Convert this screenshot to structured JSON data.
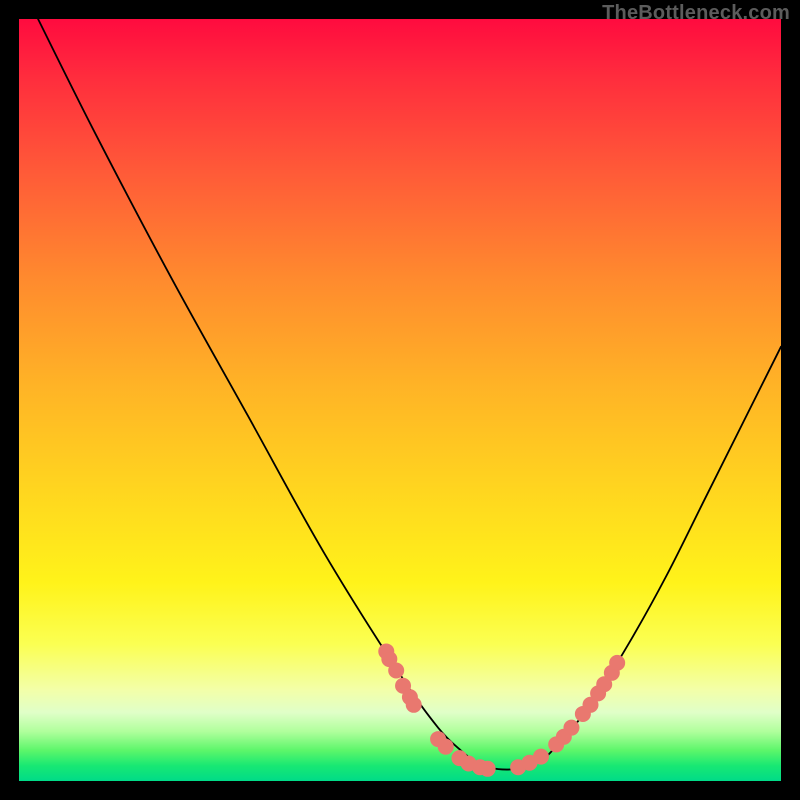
{
  "credit": "TheBottleneck.com",
  "colors": {
    "curve_stroke": "#000000",
    "marker_fill": "#e9786f",
    "marker_stroke": "#e9786f"
  },
  "chart_data": {
    "type": "line",
    "title": "",
    "xlabel": "",
    "ylabel": "",
    "xlim": [
      0,
      100
    ],
    "ylim": [
      0,
      100
    ],
    "series": [
      {
        "name": "curve",
        "x": [
          2.5,
          10,
          20,
          30,
          40,
          50,
          55,
          58,
          60,
          62,
          64,
          66,
          68,
          70,
          75,
          80,
          85,
          90,
          95,
          100
        ],
        "y": [
          100,
          85,
          66,
          48,
          30,
          14,
          7,
          4,
          2.5,
          1.7,
          1.5,
          1.7,
          2.5,
          4,
          10,
          18,
          27,
          37,
          47,
          57
        ]
      }
    ],
    "markers_left": {
      "x": [
        48.2,
        48.6,
        49.5,
        50.4,
        51.3,
        51.8,
        55.0,
        56.0,
        57.8,
        59.0,
        60.5,
        61.5
      ],
      "y": [
        17.0,
        16.0,
        14.5,
        12.5,
        11.0,
        10.0,
        5.5,
        4.5,
        3.0,
        2.3,
        1.8,
        1.6
      ]
    },
    "markers_right": {
      "x": [
        65.5,
        67.0,
        68.5,
        70.5,
        71.5,
        72.5,
        74.0,
        75.0,
        76.0,
        76.8,
        77.8,
        78.5
      ],
      "y": [
        1.8,
        2.4,
        3.2,
        4.8,
        5.8,
        7.0,
        8.8,
        10.0,
        11.5,
        12.7,
        14.2,
        15.5
      ]
    }
  }
}
